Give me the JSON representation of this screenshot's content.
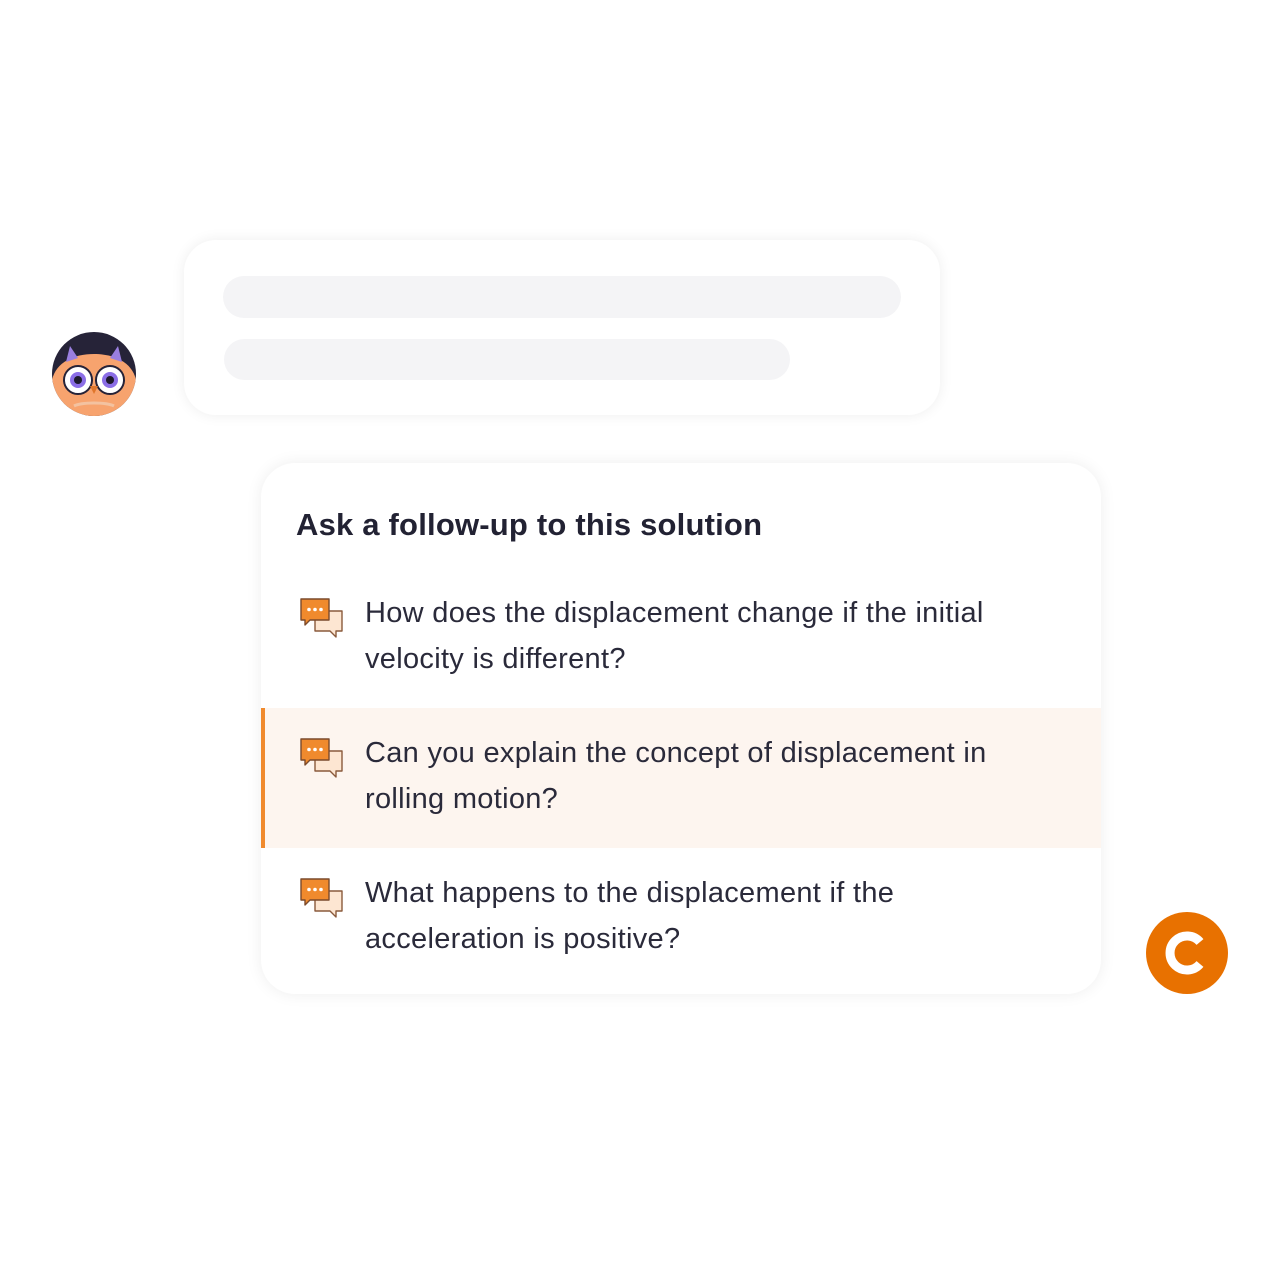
{
  "followup": {
    "title": "Ask a follow-up to this solution",
    "suggestions": [
      {
        "text": "How does the displacement change if the initial velocity is different?",
        "icon": "chat-bubbles-icon",
        "highlighted": false
      },
      {
        "text": "Can you explain the concept of displacement in rolling motion?",
        "icon": "chat-bubbles-icon",
        "highlighted": true
      },
      {
        "text": "What happens to the displacement if the acceleration is positive?",
        "icon": "chat-bubbles-icon",
        "highlighted": false
      }
    ]
  },
  "avatars": {
    "user": "owl-avatar",
    "assistant": "brand-logo"
  },
  "colors": {
    "accent": "#f08a2d",
    "highlight_bg": "#fdf5ef",
    "skeleton": "#f4f4f6",
    "brand": "#e87100",
    "text": "#2a2a3a",
    "title": "#222233"
  }
}
